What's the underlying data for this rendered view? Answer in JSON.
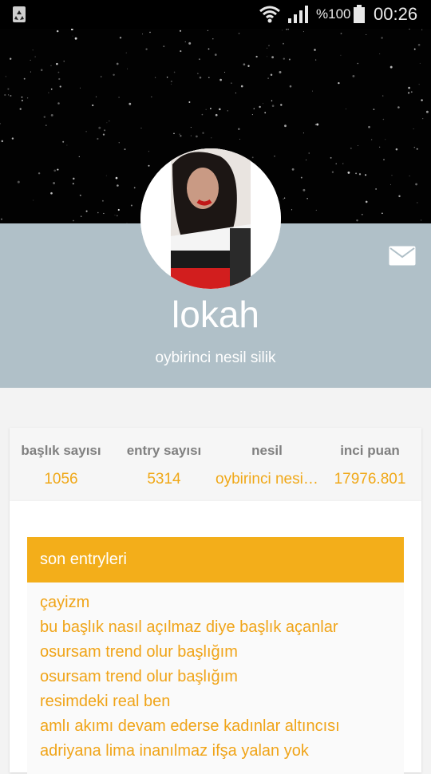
{
  "status_bar": {
    "battery_text": "%100",
    "time": "00:26"
  },
  "profile": {
    "username": "lokah",
    "subtitle": "oybirinci nesil silik"
  },
  "stats": [
    {
      "label": "başlık sayısı",
      "value": "1056"
    },
    {
      "label": "entry sayısı",
      "value": "5314"
    },
    {
      "label": "nesil",
      "value": "oybirinci nesil silik"
    },
    {
      "label": "inci puan",
      "value": "17976.801"
    }
  ],
  "entries": {
    "title": "son entryleri",
    "items": [
      "çayizm",
      "bu başlık nasıl açılmaz diye başlık açanlar",
      "osursam trend olur başlığım",
      "osursam trend olur başlığım",
      "resimdeki real ben",
      "amlı akımı devam ederse kadınlar altıncısı",
      "adriyana lima inanılmaz ifşa yalan yok"
    ]
  },
  "colors": {
    "accent": "#f3ae1a",
    "band": "#b0c0c8",
    "link": "#f0a418"
  }
}
